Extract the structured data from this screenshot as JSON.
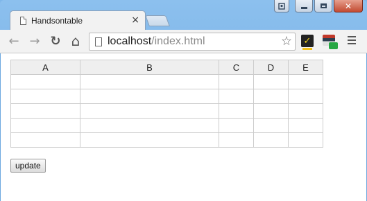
{
  "browser": {
    "tab": {
      "title": "Handsontable",
      "close_glyph": "×"
    },
    "address": {
      "host": "localhost",
      "path": "/index.html"
    },
    "nav": {
      "back": "←",
      "forward": "→",
      "reload": "↻",
      "home": "⌂"
    },
    "star": "☆",
    "extensions": [
      "norton-check-icon",
      "mail-extension-icon"
    ],
    "window_controls": [
      "user-icon",
      "minimize-icon",
      "maximize-icon",
      "close-icon"
    ]
  },
  "sheet": {
    "columns": [
      "A",
      "B",
      "C",
      "D",
      "E"
    ],
    "rows": [
      [
        "",
        "",
        "",
        "",
        ""
      ],
      [
        "",
        "",
        "",
        "",
        ""
      ],
      [
        "",
        "",
        "",
        "",
        ""
      ],
      [
        "",
        "",
        "",
        "",
        ""
      ],
      [
        "",
        "",
        "",
        "",
        ""
      ]
    ]
  },
  "actions": {
    "update_label": "update"
  },
  "colors": {
    "frame": "#7fb7ea",
    "header_bg": "#efefef",
    "cell_border": "#cccccc"
  }
}
